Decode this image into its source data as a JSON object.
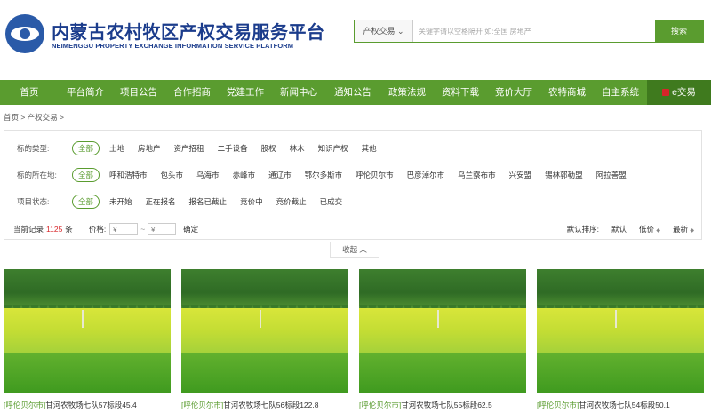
{
  "header": {
    "title": "内蒙古农村牧区产权交易服务平台",
    "subtitle": "NEIMENGGU PROPERTY EXCHANGE INFORMATION SERVICE PLATFORM",
    "search": {
      "category": "产权交易",
      "placeholder": "关键字请以空格隔开 如:全国 房地产",
      "button": "搜索"
    }
  },
  "nav": {
    "items": [
      "首页",
      "平台简介",
      "项目公告",
      "合作招商",
      "党建工作",
      "新闻中心",
      "通知公告",
      "政策法规",
      "资料下载",
      "竞价大厅",
      "农特商城",
      "自主系统",
      "e交易"
    ]
  },
  "breadcrumb": "首页 > 产权交易 >",
  "filters": {
    "type": {
      "label": "标的类型:",
      "options": [
        "全部",
        "土地",
        "房地产",
        "资产招租",
        "二手设备",
        "股权",
        "林木",
        "知识产权",
        "其他"
      ]
    },
    "region": {
      "label": "标的所在地:",
      "options": [
        "全部",
        "呼和浩特市",
        "包头市",
        "乌海市",
        "赤峰市",
        "通辽市",
        "鄂尔多斯市",
        "呼伦贝尔市",
        "巴彦淖尔市",
        "乌兰察布市",
        "兴安盟",
        "锡林郭勒盟",
        "阿拉善盟"
      ]
    },
    "status": {
      "label": "项目状态:",
      "options": [
        "全部",
        "未开始",
        "正在报名",
        "报名已截止",
        "竞价中",
        "竞价截止",
        "已成交"
      ]
    }
  },
  "stats": {
    "prefix": "当前记录",
    "count": "1125",
    "suffix": "条",
    "price_label": "价格:",
    "price_min_placeholder": "¥",
    "price_max_placeholder": "¥",
    "tilde": "~",
    "confirm": "确定",
    "sort_label": "默认排序:",
    "sort_default": "默认",
    "sort_price": "低价",
    "sort_latest": "最新"
  },
  "collapse": "收起 ︿",
  "cards": [
    {
      "location": "[呼伦贝尔市]",
      "title": "甘河农牧场七队57标段45.4"
    },
    {
      "location": "[呼伦贝尔市]",
      "title": "甘河农牧场七队56标段122.8"
    },
    {
      "location": "[呼伦贝尔市]",
      "title": "甘河农牧场七队55标段62.5"
    },
    {
      "location": "[呼伦贝尔市]",
      "title": "甘河农牧场七队54标段50.1"
    }
  ],
  "colors": {
    "brand_green": "#5a9c2f",
    "title_blue": "#1b3c8c",
    "highlight_red": "#d7262a"
  }
}
